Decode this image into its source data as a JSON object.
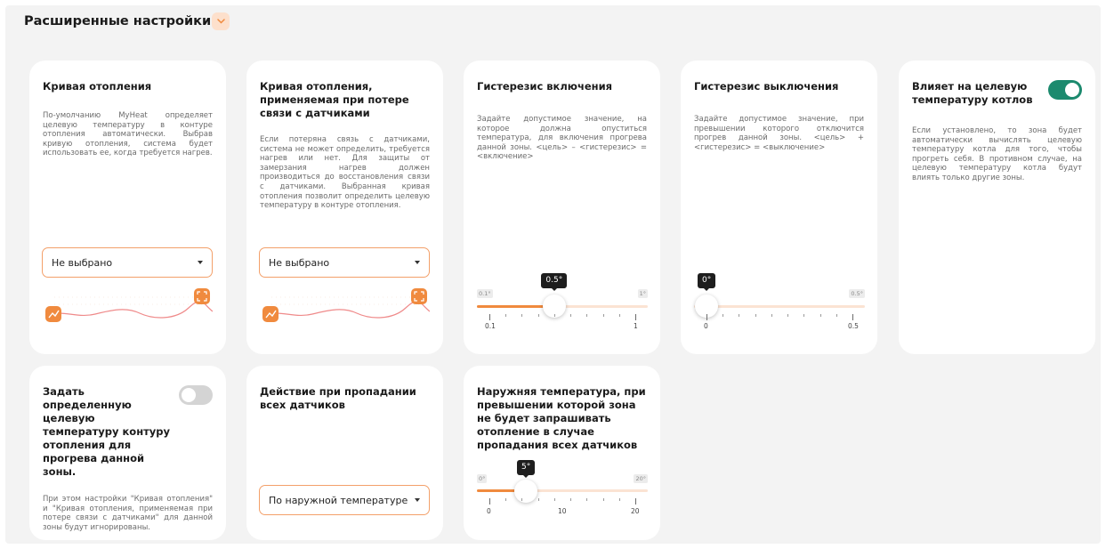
{
  "section": {
    "title": "Расширенные настройки"
  },
  "colors": {
    "accent": "#f08a3e",
    "toggle_on": "#1c8a6e",
    "toggle_off": "#d4d4d4"
  },
  "cards": {
    "heating_curve": {
      "title": "Кривая отопления",
      "desc": "По-умолчанию MyHeat определяет целевую температуру в контуре отопления автоматически. Выбрав кривую отопления, система будет использовать ее, когда требуется нагрев.",
      "select_value": "Не выбрано"
    },
    "heating_curve_lost": {
      "title": "Кривая отопления, применяемая при потере связи с датчиками",
      "desc": "Если потеряна связь с датчиками, система не может определить, требуется нагрев или нет. Для защиты от замерзания нагрев должен производиться до восстановления связи с датчиками. Выбранная кривая отопления позволит определить целевую температуру в контуре отопления.",
      "select_value": "Не выбрано"
    },
    "hysteresis_on": {
      "title": "Гистерезис включения",
      "desc": "Задайте допустимое значение, на которое должна опуститься температура, для включения прогрева данной зоны. <цель> – <гистерезис> = <включение>",
      "min_label": "0.1°",
      "max_label": "1°",
      "value_label": "0.5°",
      "tick_min": "0.1",
      "tick_max": "1",
      "min": 0.1,
      "max": 1,
      "value": 0.5
    },
    "hysteresis_off": {
      "title": "Гистерезис выключения",
      "desc": "Задайте допустимое значение, при превышении которого отключится прогрев данной зоны. <цель> + <гистерезис> = <выключение>",
      "max_label": "0.5°",
      "value_label": "0°",
      "tick_min": "0",
      "tick_max": "0.5",
      "min": 0,
      "max": 0.5,
      "value": 0
    },
    "affects_boiler": {
      "title": "Влияет на целевую температуру котлов",
      "desc": "Если установлено, то зона будет автоматически вычислять целевую температуру котла для того, чтобы прогреть себя. В противном случае, на целевую температуру котла будут влиять только другие зоны.",
      "enabled": true
    },
    "set_target": {
      "title": "Задать определенную целевую температуру контуру отопления для прогрева данной зоны.",
      "desc": "При этом настройки \"Кривая отопления\" и \"Кривая отопления, применяемая при потере связи с датчиками\" для данной зоны будут игнорированы.",
      "enabled": false
    },
    "sensor_loss_action": {
      "title": "Действие при пропадании всех датчиков",
      "select_value": "По наружной температуре"
    },
    "outdoor_temp": {
      "title": "Наружняя температура, при превышении которой зона не будет запрашивать отопление в случае пропадания всех датчиков",
      "min_label": "0°",
      "max_label": "20°",
      "value_label": "5°",
      "tick_min": "0",
      "tick_mid": "10",
      "tick_max": "20",
      "min": 0,
      "max": 20,
      "value": 5
    }
  }
}
